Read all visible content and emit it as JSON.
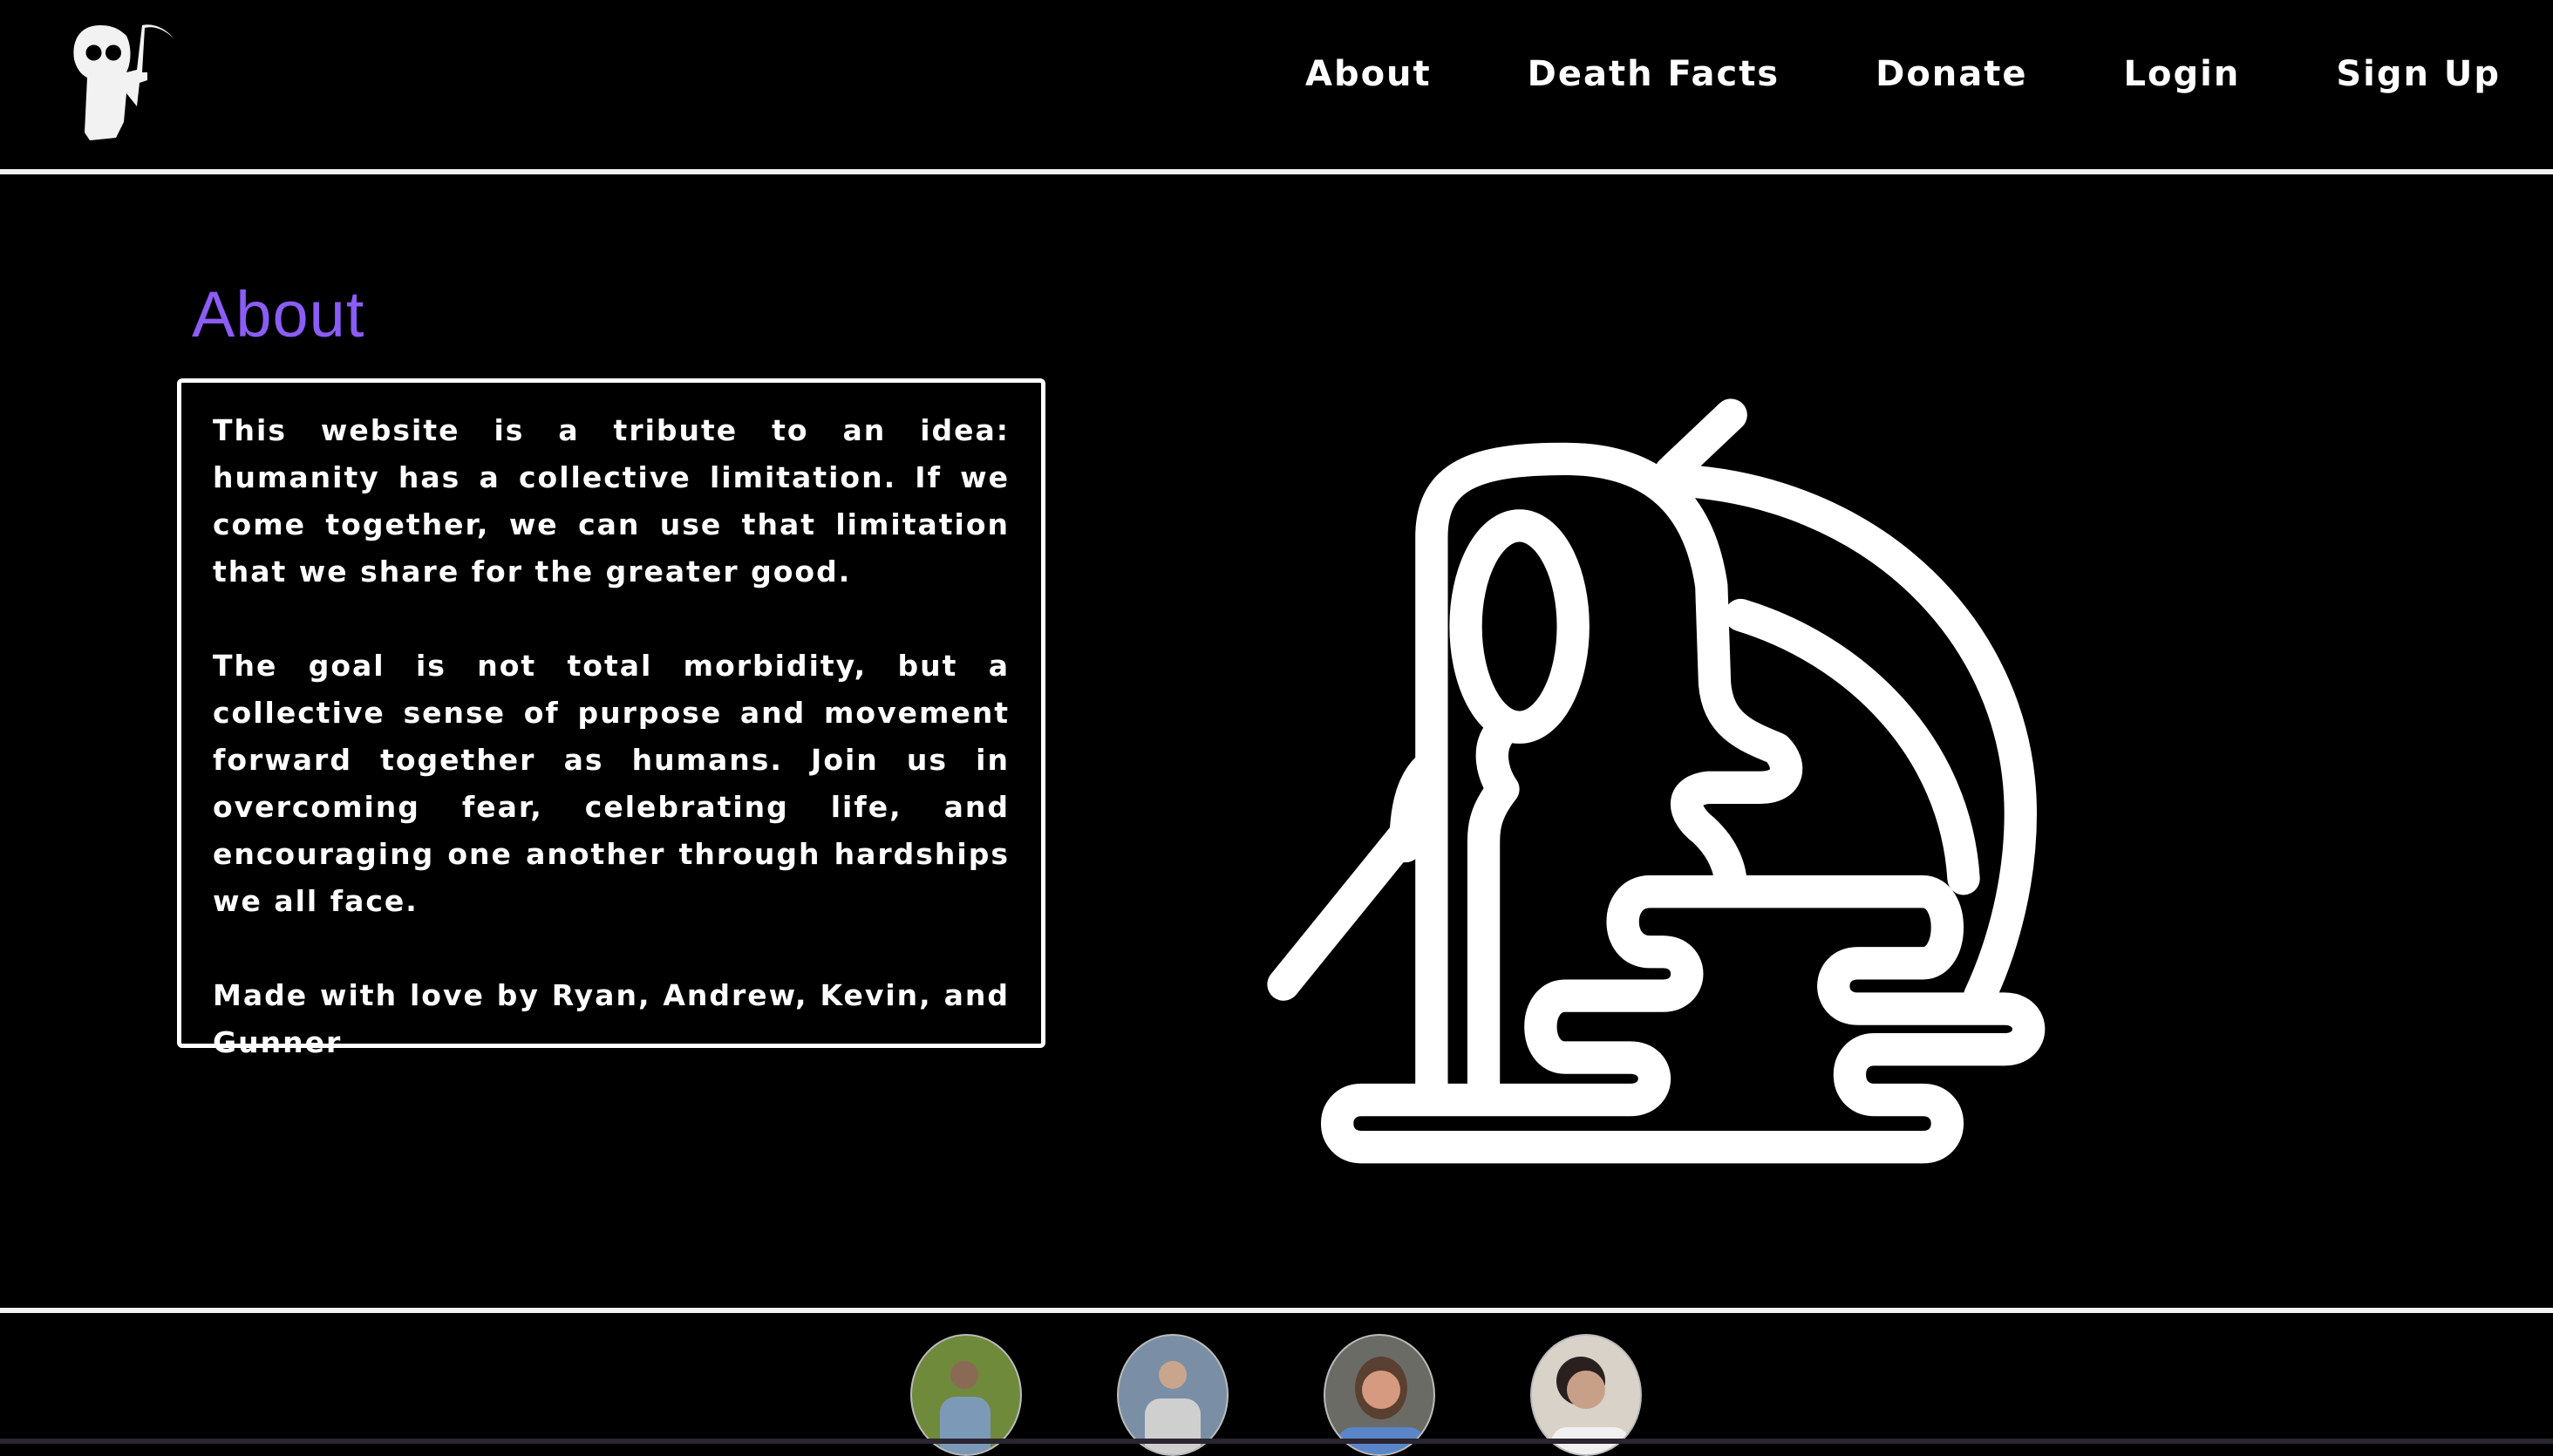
{
  "nav": {
    "items": [
      "About",
      "Death Facts",
      "Donate",
      "Login",
      "Sign Up"
    ]
  },
  "about": {
    "title": "About",
    "paragraphs": [
      "This website is a tribute to an idea: humanity has a collective limitation. If we come together, we can use that limitation that we share for the greater good.",
      "The goal is not total morbidity, but a collective sense of purpose and movement forward together as humans. Join us in overcoming fear, celebrating life, and encouraging one another through hardships we all face.",
      "Made with love by Ryan, Andrew, Kevin, and Gunner"
    ]
  },
  "colors": {
    "accent": "#8b5cf6",
    "background": "#000000",
    "foreground": "#ffffff"
  },
  "footer": {
    "avatars": [
      {
        "bg": "#6f8a3a",
        "shirt": "#7c9ab8"
      },
      {
        "bg": "#7a8fa5",
        "shirt": "#cfcfcf"
      },
      {
        "bg": "#6b6b66",
        "shirt": "#5a86c9"
      },
      {
        "bg": "#d8d2c8",
        "shirt": "#f0f0f0"
      }
    ]
  }
}
